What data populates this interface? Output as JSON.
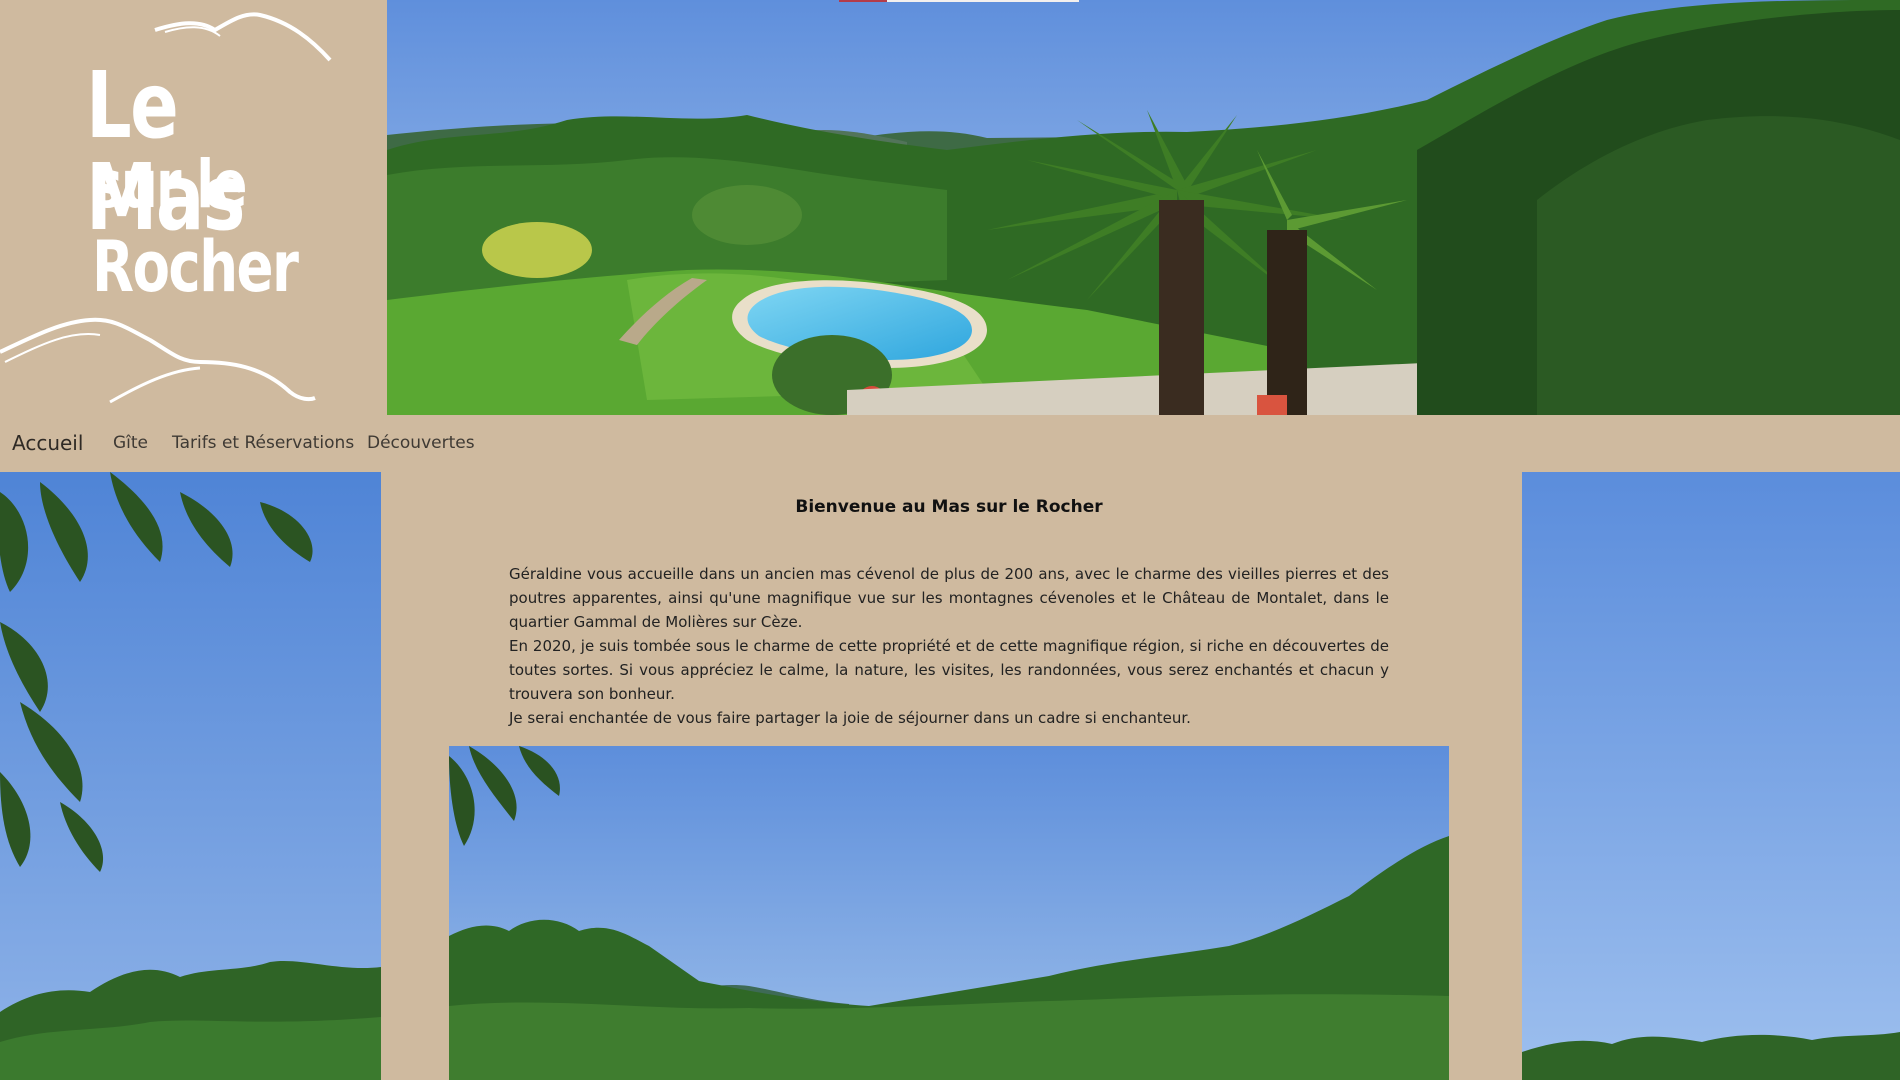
{
  "logo": {
    "line1": "Le Mas",
    "line2": "sur le",
    "line3": "Rocher",
    "icon": "mountain-outline-logo"
  },
  "nav": {
    "items": [
      {
        "label": "Accueil",
        "active": true
      },
      {
        "label": "Gîte"
      },
      {
        "label": "Tarifs et Réservations"
      },
      {
        "label": "Découvertes"
      }
    ]
  },
  "content": {
    "heading": "Bienvenue au Mas sur le Rocher",
    "paragraphs": [
      "Géraldine vous accueille dans un ancien mas cévenol de plus de 200 ans, avec le charme des vieilles pierres et des poutres apparentes, ainsi qu'une magnifique vue sur les montagnes cévenoles et le Château de Montalet, dans le quartier Gammal de Molières sur Cèze.",
      "En 2020, je suis tombée sous le charme de cette propriété et de cette magnifique région, si riche en découvertes de toutes sortes. Si vous appréciez le calme, la nature, les visites, les randonnées, vous serez enchantés et chacun y trouvera son bonheur.",
      "Je serai enchantée de vous faire partager la joie de séjourner dans un cadre si enchanteur."
    ]
  },
  "colors": {
    "beige": "#cfba9f",
    "sky": "#6f9be0",
    "foliage": "#3f7a2d",
    "pool": "#5cc3ea"
  }
}
